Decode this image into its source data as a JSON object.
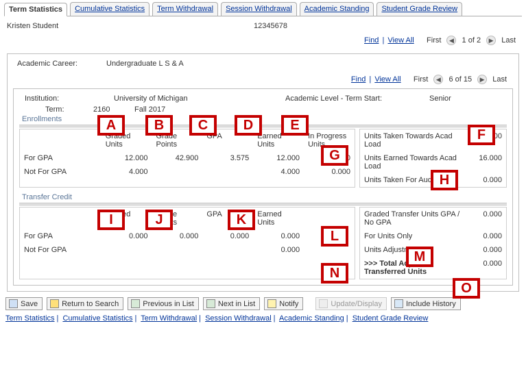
{
  "tabs": [
    "Term Statistics",
    "Cumulative Statistics",
    "Term Withdrawal",
    "Session Withdrawal",
    "Academic Standing",
    "Student Grade Review"
  ],
  "active_tab_index": 0,
  "student": {
    "name": "Kristen Student",
    "id": "12345678"
  },
  "nav": {
    "find": "Find",
    "view_all": "View All",
    "first": "First",
    "last": "Last",
    "outer_pos": "1 of 2",
    "inner_pos": "6 of 15"
  },
  "career": {
    "label": "Academic Career:",
    "value": "Undergraduate L S & A"
  },
  "inst": {
    "label": "Institution:",
    "value": "University of Michigan"
  },
  "term": {
    "label": "Term:",
    "code": "2160",
    "name": "Fall 2017"
  },
  "level": {
    "label": "Academic Level - Term Start:",
    "value": "Senior"
  },
  "sections": {
    "enroll": "Enrollments",
    "xfer": "Transfer Credit"
  },
  "row_labels": {
    "for_gpa": "For GPA",
    "not_for_gpa": "Not For GPA"
  },
  "cols": {
    "graded_units": "Graded Units",
    "grade_points": "Grade Points",
    "gpa": "GPA",
    "earned_units": "Earned Units",
    "in_progress": "In Progress Units"
  },
  "enrollments": {
    "for_gpa": {
      "graded_units": "12.000",
      "grade_points": "42.900",
      "gpa": "3.575",
      "earned_units": "12.000",
      "in_progress": "0.000"
    },
    "not_for_gpa": {
      "graded_units": "4.000",
      "grade_points": "",
      "gpa": "",
      "earned_units": "4.000",
      "in_progress": "0.000"
    }
  },
  "enroll_right": {
    "taken_load": {
      "label": "Units Taken Towards Acad Load",
      "value": "16.000"
    },
    "earned_load": {
      "label": "Units Earned Towards Acad Load",
      "value": "16.000"
    },
    "audit": {
      "label": "Units Taken For Audit",
      "value": "0.000"
    }
  },
  "transfer": {
    "for_gpa": {
      "graded_units": "0.000",
      "grade_points": "0.000",
      "gpa": "0.000",
      "earned_units": "0.000"
    },
    "not_for_gpa": {
      "graded_units": "",
      "grade_points": "",
      "gpa": "",
      "earned_units": "0.000"
    }
  },
  "xfer_right": {
    "gpa_no_gpa": {
      "label": "Graded Transfer Units GPA / No GPA",
      "value": "0.000"
    },
    "units_only": {
      "label": "For Units Only",
      "value": "0.000"
    },
    "adjust": {
      "label": "Units Adjustment",
      "value": "0.000"
    },
    "total": {
      "label": ">>> Total Adjusted Transferred Units",
      "value": "0.000"
    }
  },
  "buttons": {
    "save": "Save",
    "return": "Return to Search",
    "prev": "Previous in List",
    "next": "Next in List",
    "notify": "Notify",
    "update": "Update/Display",
    "hist": "Include History"
  },
  "bottom_links": [
    "Term Statistics",
    "Cumulative Statistics",
    "Term Withdrawal",
    "Session Withdrawal",
    "Academic Standing",
    "Student Grade Review"
  ],
  "annotations": [
    "A",
    "B",
    "C",
    "D",
    "E",
    "F",
    "G",
    "H",
    "I",
    "J",
    "K",
    "L",
    "M",
    "N",
    "O"
  ]
}
